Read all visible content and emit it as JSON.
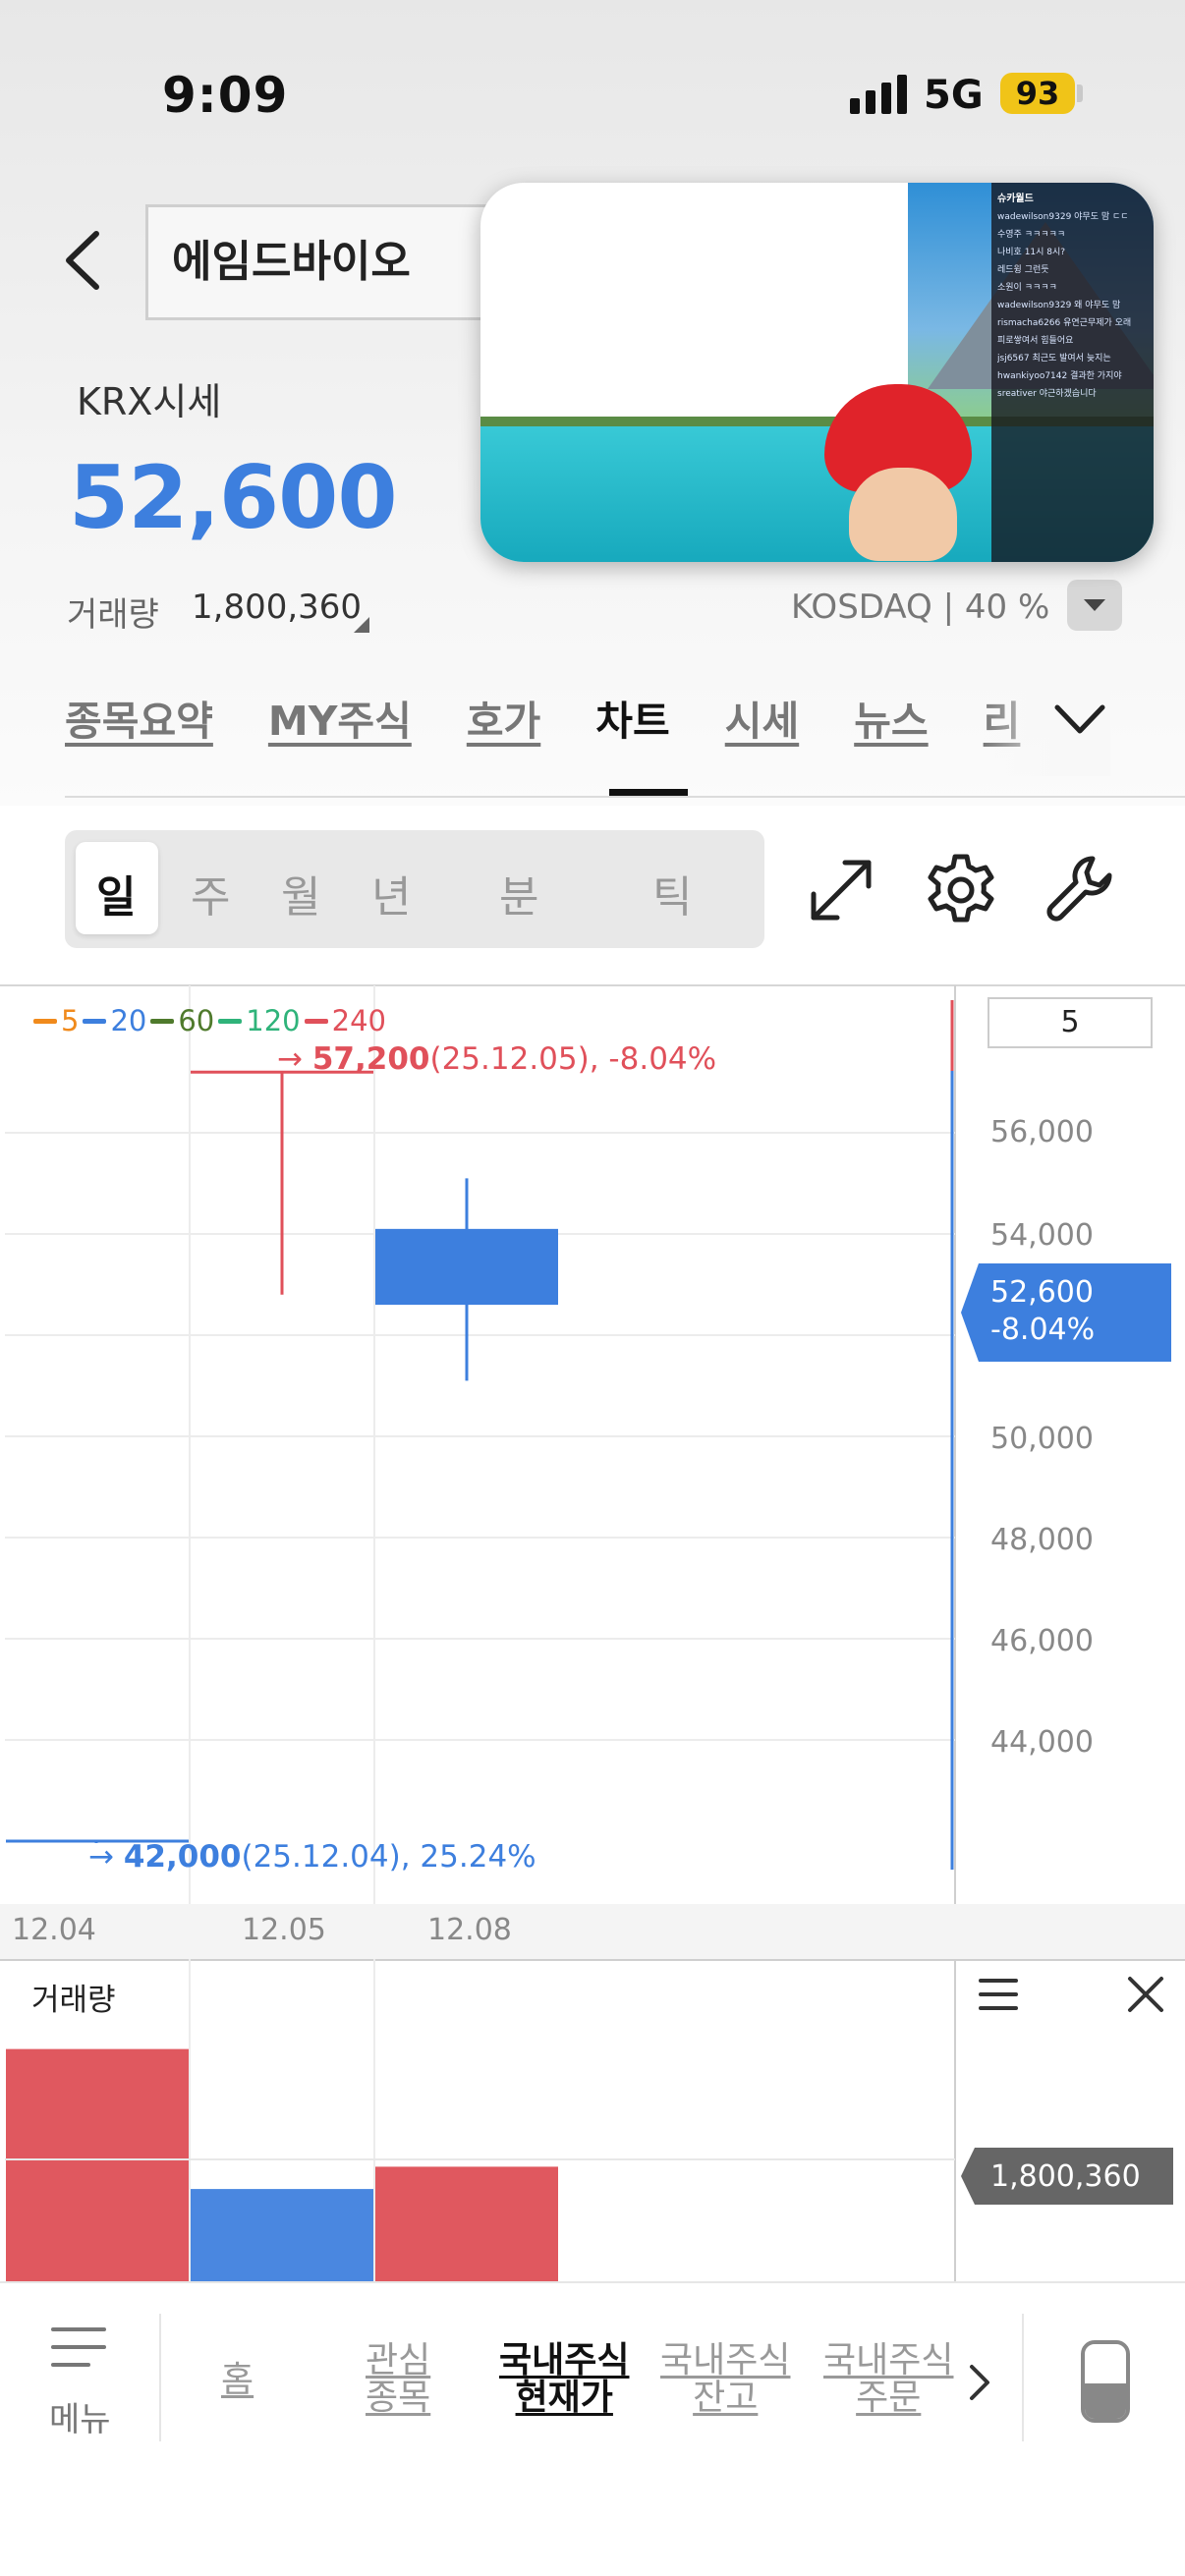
{
  "status_bar": {
    "time": "9:09",
    "network": "5G",
    "battery": "93"
  },
  "header": {
    "stock_name": "에임드바이오"
  },
  "price_info": {
    "source_label": "KRX시세",
    "price": "52,600",
    "volume_label": "거래량",
    "volume_value": "1,800,360",
    "market": "KOSDAQ",
    "percent": "40 %"
  },
  "tabs": [
    {
      "label": "종목요약"
    },
    {
      "label": "MY주식"
    },
    {
      "label": "호가"
    },
    {
      "label": "차트",
      "active": true
    },
    {
      "label": "시세"
    },
    {
      "label": "뉴스"
    },
    {
      "label": "리"
    }
  ],
  "periods": [
    {
      "label": "일",
      "active": true
    },
    {
      "label": "주"
    },
    {
      "label": "월"
    },
    {
      "label": "년"
    },
    {
      "label": "분"
    },
    {
      "label": "틱"
    }
  ],
  "pip_chat": {
    "channel": "슈카월드",
    "messages": [
      "wadewilson9329 야무도 맘 ㄷㄷ",
      "수영주 ㅋㅋㅋㅋㅋ",
      "나비호 11시 8시?",
      "레드윙 그런듯",
      "소원이 ㅋㅋㅋㅋ",
      "wadewilson9329 왜 야무도 맘",
      "rismacha6266 유연근무제가 오래",
      "피로쌓여서 힘들어요",
      "jsj6567 최근도 발여서 늦지는",
      "hwankiyoo7142 결과한 가지야",
      "sreativer 야근하겠습니다"
    ]
  },
  "chart_data": {
    "type": "candlestick",
    "legend": [
      {
        "name": "5",
        "color": "#f08a1c"
      },
      {
        "name": "20",
        "color": "#3d7fde"
      },
      {
        "name": "60",
        "color": "#4f7a2c"
      },
      {
        "name": "120",
        "color": "#2fb37a"
      },
      {
        "name": "240",
        "color": "#e0505a"
      }
    ],
    "period_value": "5",
    "categories": [
      "12.04",
      "12.05",
      "12.08"
    ],
    "candles": [
      {
        "date": "12.04",
        "open": 42000,
        "close": 42000,
        "high": 42000,
        "low": 42000,
        "color": "#3d7fde"
      },
      {
        "date": "12.05",
        "open": 57200,
        "close": 57200,
        "high": 57200,
        "low": 52800,
        "color": "#e0505a"
      },
      {
        "date": "12.08",
        "open": 54100,
        "close": 52600,
        "high": 55100,
        "low": 51100,
        "color": "#3d7fde"
      }
    ],
    "yticks": [
      "56,000",
      "54,000",
      "50,000",
      "48,000",
      "46,000",
      "44,000"
    ],
    "ylim": [
      40800,
      58300
    ],
    "high_annotation": {
      "value": "57,200",
      "detail": "(25.12.05), -8.04%"
    },
    "low_annotation": {
      "value": "42,000",
      "detail": "(25.12.04), 25.24%"
    },
    "current": {
      "price": "52,600",
      "change": "-8.04%",
      "color": "#3d7fde"
    },
    "volume": {
      "title": "거래량",
      "values": [
        3650000,
        1450000,
        1800360
      ],
      "colors": [
        "#e0585f",
        "#4a87e0",
        "#e0585f"
      ],
      "ymax": 4200000,
      "current": "1,800,360"
    }
  },
  "bottom_nav": {
    "menu": "메뉴",
    "items": [
      {
        "label": "홈"
      },
      {
        "label": "관심\n종목"
      },
      {
        "label": "국내주식\n현재가",
        "active": true
      },
      {
        "label": "국내주식\n잔고"
      },
      {
        "label": "국내주식\n주문"
      }
    ]
  },
  "colors": {
    "accent_blue": "#3d7fde",
    "accent_red": "#e0505a"
  }
}
